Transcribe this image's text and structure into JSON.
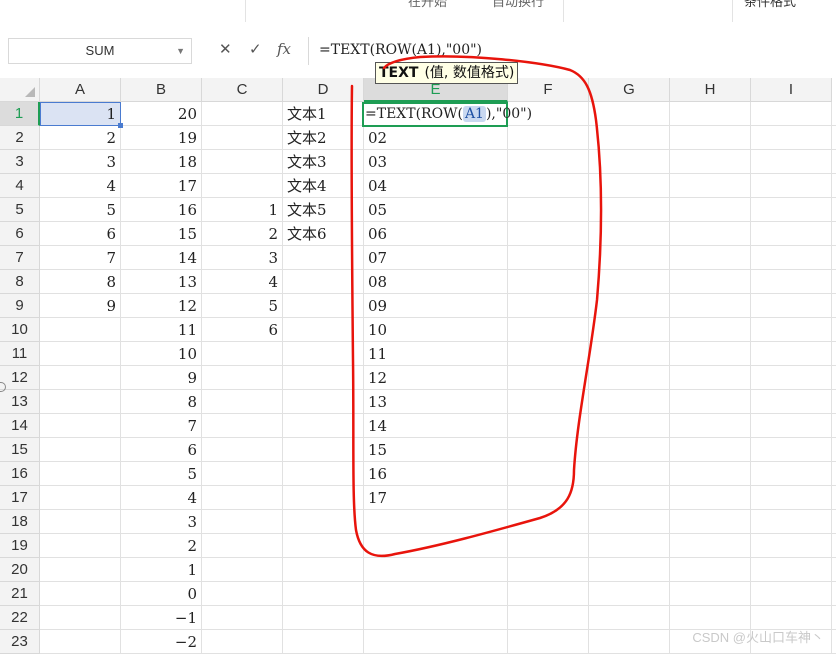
{
  "toolbar": {
    "item_open_start": "在开始",
    "item_autofill": "自动换行",
    "item_cond_format": "条件格式"
  },
  "formula_bar": {
    "name_box": "SUM",
    "cancel_icon": "✕",
    "confirm_icon": "✓",
    "fx_label": "fx",
    "formula": "=TEXT(ROW(A1),\"00\")"
  },
  "grid": {
    "columns": [
      "A",
      "B",
      "C",
      "D",
      "E",
      "F",
      "G",
      "H",
      "I"
    ],
    "active_column": "E",
    "active_row": "1",
    "rows": [
      "1",
      "2",
      "3",
      "4",
      "5",
      "6",
      "7",
      "8",
      "9",
      "10",
      "11",
      "12",
      "13",
      "14",
      "15",
      "16",
      "17",
      "18",
      "19",
      "20",
      "21",
      "22",
      "23"
    ],
    "col_a": [
      "1",
      "2",
      "3",
      "4",
      "5",
      "6",
      "7",
      "8",
      "9"
    ],
    "col_b": [
      "20",
      "19",
      "18",
      "17",
      "16",
      "15",
      "14",
      "13",
      "12",
      "11",
      "10",
      "9",
      "8",
      "7",
      "6",
      "5",
      "4",
      "3",
      "2",
      "1",
      "0",
      "−1",
      "−2"
    ],
    "col_c": [
      "1",
      "2",
      "3",
      "4",
      "5",
      "6"
    ],
    "col_d": [
      "文本1",
      "文本2",
      "文本3",
      "文本4",
      "文本5",
      "文本6"
    ],
    "col_e": [
      "",
      "02",
      "03",
      "04",
      "05",
      "06",
      "07",
      "08",
      "09",
      "10",
      "11",
      "12",
      "13",
      "14",
      "15",
      "16",
      "17"
    ],
    "editing_cell": {
      "before": "=TEXT(ROW(",
      "ref": "A1",
      "after": "),\"00\")"
    }
  },
  "tooltip": {
    "function": "TEXT",
    "args": "(值, 数值格式)"
  },
  "annotation": {
    "color": "#e8140c"
  },
  "watermark": "CSDN @火山口车神丶"
}
